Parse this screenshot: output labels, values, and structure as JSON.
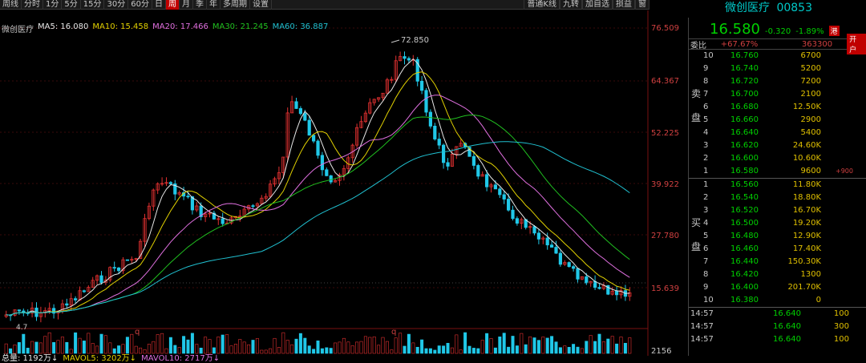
{
  "toolbar": {
    "period_tabs": [
      "周线",
      "分时",
      "1分",
      "5分",
      "15分",
      "30分",
      "60分",
      "日",
      "周",
      "月",
      "季",
      "年",
      "多周期",
      "设置"
    ],
    "active_tab": "周",
    "right_tabs": [
      "普通K线",
      "九转",
      "加自选",
      "损益",
      "窗"
    ]
  },
  "header": {
    "stock_name": "微创医疗",
    "stock_code": "00853"
  },
  "chart": {
    "stock_label": "微创医疗",
    "ma_legend": [
      {
        "label": "MA5: 16.080",
        "color": "#e8e8e8"
      },
      {
        "label": "MA10: 15.458",
        "color": "#e0d000"
      },
      {
        "label": "MA20: 17.466",
        "color": "#e070e0"
      },
      {
        "label": "MA30: 21.245",
        "color": "#20c020"
      },
      {
        "label": "MA60: 36.887",
        "color": "#20c0d0"
      }
    ],
    "y_axis_labels": [
      "76.509",
      "64.367",
      "52.225",
      "39.922",
      "27.780",
      "15.639"
    ],
    "volume_axis_label": "2156",
    "high_marker": "72.850",
    "low_marker": "4.7",
    "q_markers": [
      "q",
      "q"
    ],
    "colors": {
      "up": "#e03030",
      "down": "#20c8e8",
      "ma5": "#e8e8e8",
      "ma10": "#e0d000",
      "ma20": "#e070e0",
      "ma30": "#20c020",
      "ma60": "#20c0d0"
    }
  },
  "volume_legend": [
    {
      "label": "总量: 1192万↓",
      "color": "#e8e8e8"
    },
    {
      "label": "MAVOL5: 3202万↓",
      "color": "#e0d000"
    },
    {
      "label": "MAVOL10: 2717万↓",
      "color": "#e070e0"
    }
  ],
  "quote": {
    "last_price": "16.580",
    "change": "-0.320",
    "change_pct": "-1.89%",
    "hk_badge": "港",
    "weibi_label": "委比",
    "weibi_pct": "+67.67%",
    "weibi_diff": "363300",
    "open_account": "开户",
    "sell_label": [
      "卖",
      "盘"
    ],
    "buy_label": [
      "买",
      "盘"
    ],
    "asks": [
      {
        "level": "10",
        "price": "16.760",
        "qty": "6700",
        "extra": ""
      },
      {
        "level": "9",
        "price": "16.740",
        "qty": "5200",
        "extra": ""
      },
      {
        "level": "8",
        "price": "16.720",
        "qty": "7200",
        "extra": ""
      },
      {
        "level": "7",
        "price": "16.700",
        "qty": "2100",
        "extra": ""
      },
      {
        "level": "6",
        "price": "16.680",
        "qty": "12.50K",
        "extra": ""
      },
      {
        "level": "5",
        "price": "16.660",
        "qty": "2900",
        "extra": ""
      },
      {
        "level": "4",
        "price": "16.640",
        "qty": "5400",
        "extra": ""
      },
      {
        "level": "3",
        "price": "16.620",
        "qty": "24.60K",
        "extra": ""
      },
      {
        "level": "2",
        "price": "16.600",
        "qty": "10.60K",
        "extra": ""
      },
      {
        "level": "1",
        "price": "16.580",
        "qty": "9600",
        "extra": "+900"
      }
    ],
    "bids": [
      {
        "level": "1",
        "price": "16.560",
        "qty": "11.80K"
      },
      {
        "level": "2",
        "price": "16.540",
        "qty": "18.80K"
      },
      {
        "level": "3",
        "price": "16.520",
        "qty": "16.70K"
      },
      {
        "level": "4",
        "price": "16.500",
        "qty": "19.20K"
      },
      {
        "level": "5",
        "price": "16.480",
        "qty": "12.90K"
      },
      {
        "level": "6",
        "price": "16.460",
        "qty": "17.40K"
      },
      {
        "level": "7",
        "price": "16.440",
        "qty": "150.30K"
      },
      {
        "level": "8",
        "price": "16.420",
        "qty": "1300"
      },
      {
        "level": "9",
        "price": "16.400",
        "qty": "201.70K"
      },
      {
        "level": "10",
        "price": "16.380",
        "qty": "0"
      }
    ],
    "trades": [
      {
        "time": "14:57",
        "price": "16.640",
        "vol": "100"
      },
      {
        "time": "14:57",
        "price": "16.640",
        "vol": "300"
      },
      {
        "time": "14:57",
        "price": "16.640",
        "vol": "100"
      }
    ]
  }
}
